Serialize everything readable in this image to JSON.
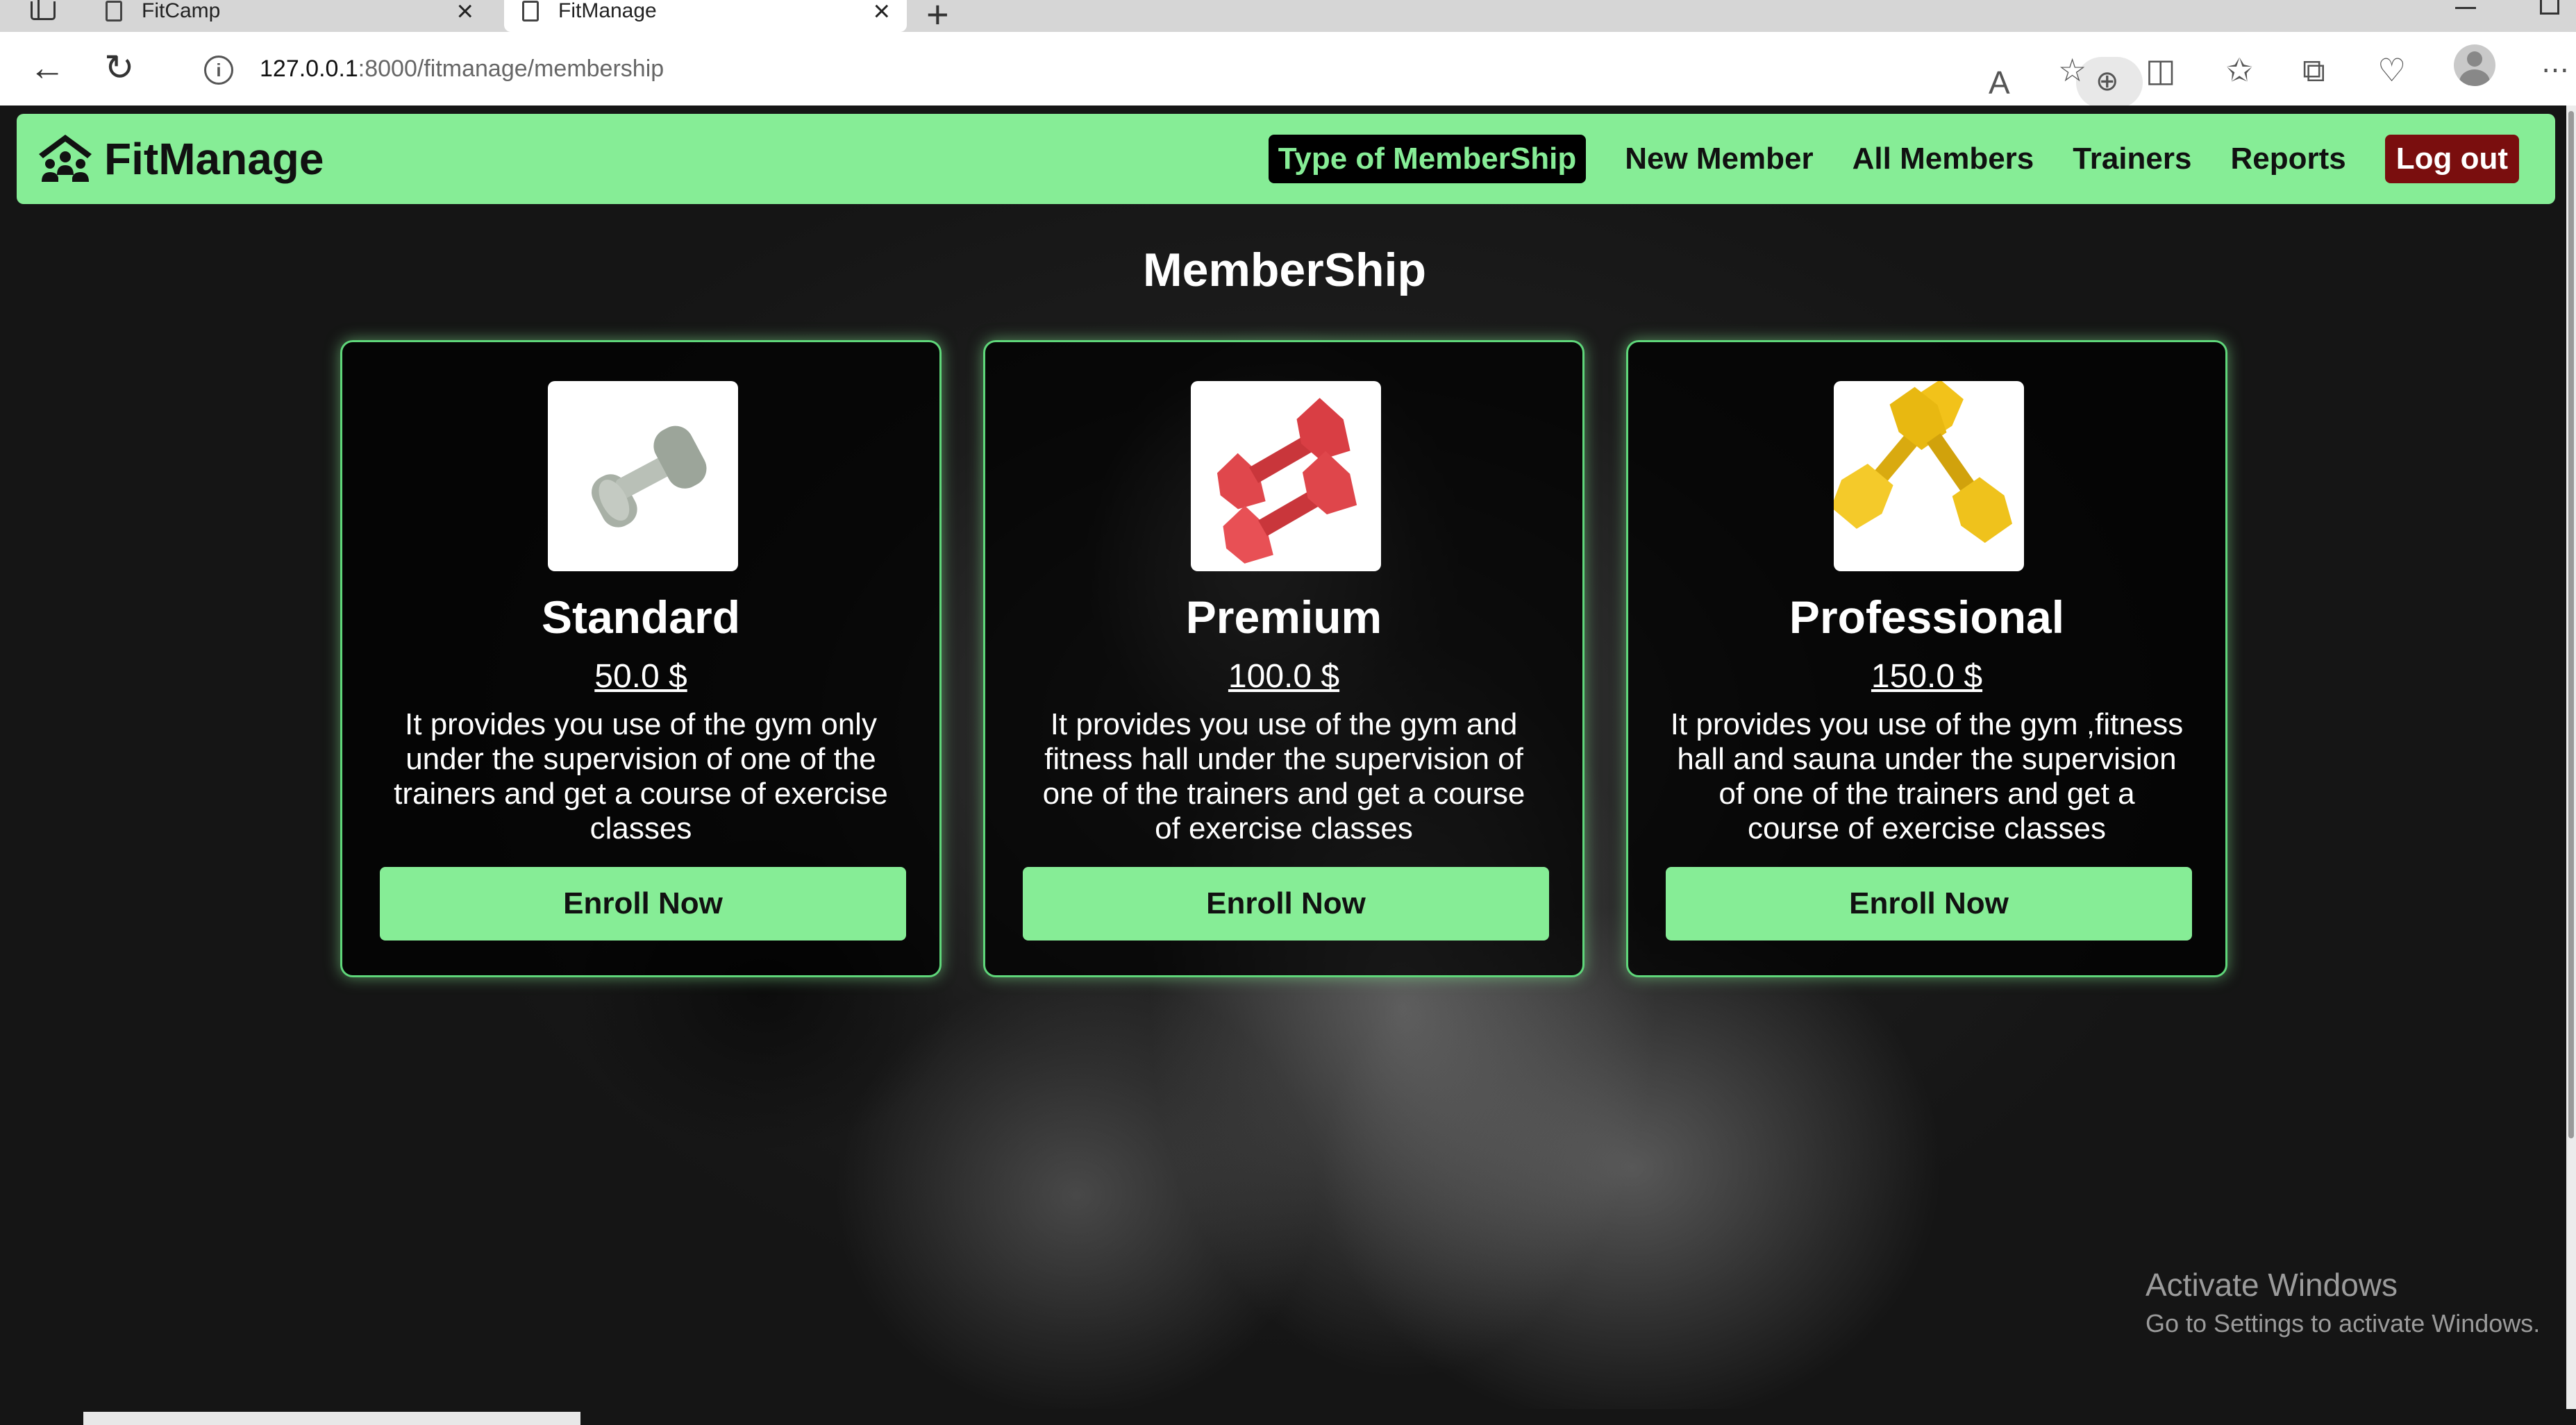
{
  "browser": {
    "tabs": [
      {
        "title": "FitCamp",
        "active": false
      },
      {
        "title": "FitManage",
        "active": true
      }
    ],
    "url_host": "127.0.0.1",
    "url_path": ":8000/fitmanage/membership"
  },
  "navbar": {
    "brand": "FitManage",
    "links": {
      "membership_types": "Type of MemberShip",
      "new_member": "New Member",
      "all_members": "All Members",
      "trainers": "Trainers",
      "reports": "Reports",
      "logout": "Log out"
    },
    "colors": {
      "bar": "#86ed96",
      "active_bg": "#000000",
      "logout_bg": "#7a0e0e"
    }
  },
  "page": {
    "title": "MemberShip"
  },
  "plans": [
    {
      "name": "Standard",
      "price": "50.0 $",
      "description": "It provides you use of the gym only under the supervision of one of the trainers and get a course of exercise classes",
      "button": "Enroll Now",
      "image": "gray-dumbbell",
      "color": "#a8b0a6"
    },
    {
      "name": "Premium",
      "price": "100.0 $",
      "description": "It provides you use of the gym and fitness hall under the supervision of one of the trainers and get a course of exercise classes",
      "button": "Enroll Now",
      "image": "red-dumbbells",
      "color": "#e0474c"
    },
    {
      "name": "Professional",
      "price": "150.0 $",
      "description": "It provides you use of the gym ,fitness hall and sauna under the supervision of one of the trainers and get a course of exercise classes",
      "button": "Enroll Now",
      "image": "yellow-dumbbells",
      "color": "#f2c21a"
    }
  ],
  "os": {
    "watermark_title": "Activate Windows",
    "watermark_sub": "Go to Settings to activate Windows."
  }
}
